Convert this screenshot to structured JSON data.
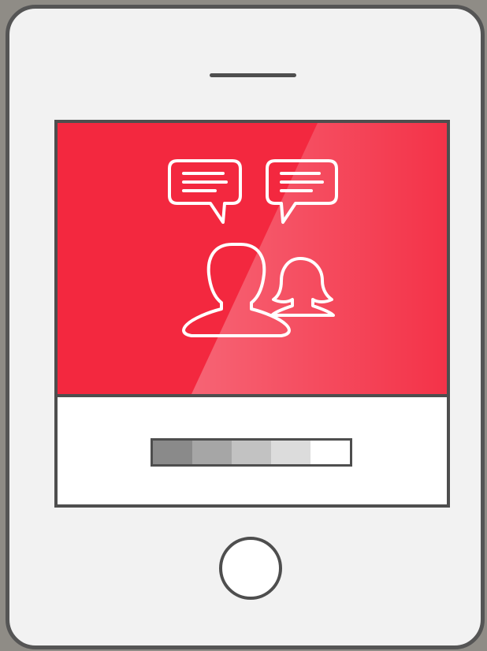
{
  "colors": {
    "screen_accent": "#f3283f",
    "frame": "#4e4e4e",
    "device_body": "#f2f2f2"
  },
  "illustration": {
    "icons": [
      "speech-bubble-icon",
      "speech-bubble-icon",
      "person-icon",
      "person-icon"
    ]
  },
  "loading_bar": {
    "progress": 0.8,
    "segment_colors": [
      "#8a8a8a",
      "#a6a6a6",
      "#c2c2c2",
      "#dcdcdc",
      "#ffffff"
    ]
  }
}
